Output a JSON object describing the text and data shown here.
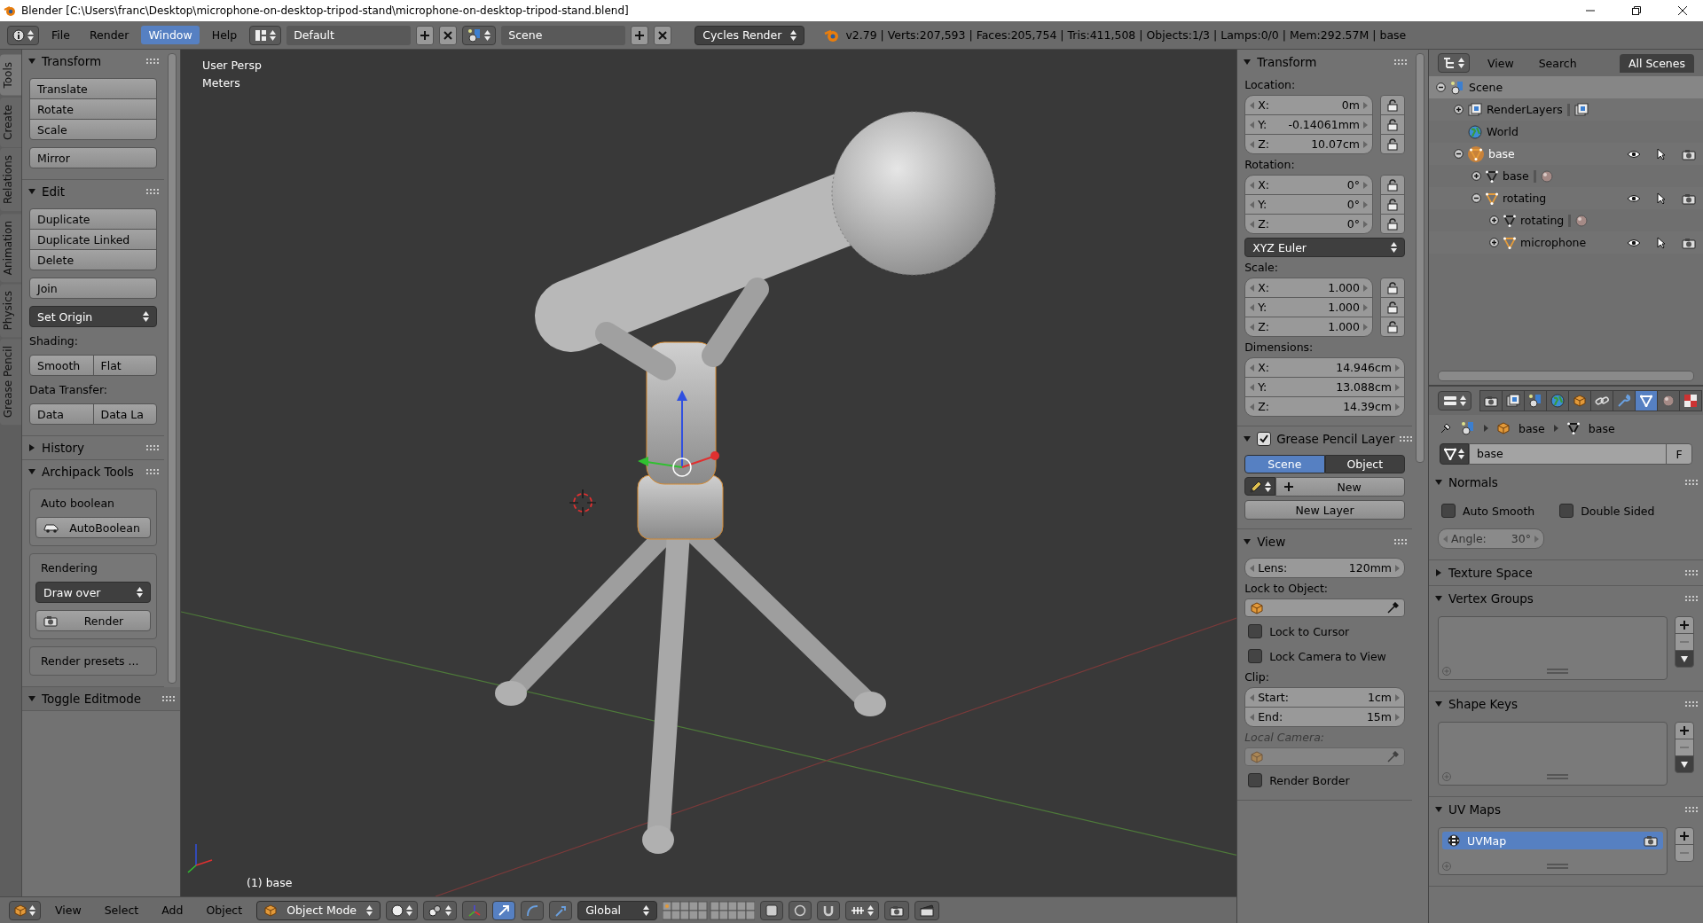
{
  "title_bar": {
    "title": "Blender [C:\\Users\\franc\\Desktop\\microphone-on-desktop-tripod-stand\\microphone-on-desktop-tripod-stand.blend]"
  },
  "top_header": {
    "menus": [
      {
        "label": "File",
        "selected": false
      },
      {
        "label": "Render",
        "selected": false
      },
      {
        "label": "Window",
        "selected": true
      },
      {
        "label": "Help",
        "selected": false
      }
    ],
    "layout": "Default",
    "scene": "Scene",
    "engine": "Cycles Render",
    "stats": "v2.79 | Verts:207,593 | Faces:205,754 | Tris:411,508 | Objects:1/3 | Lamps:0/0 | Mem:292.57M | base"
  },
  "tool_tabs": [
    {
      "label": "Tools",
      "selected": true
    },
    {
      "label": "Create",
      "selected": false
    },
    {
      "label": "Relations",
      "selected": false
    },
    {
      "label": "Animation",
      "selected": false
    },
    {
      "label": "Physics",
      "selected": false
    },
    {
      "label": "Grease Pencil",
      "selected": false
    }
  ],
  "tool_panel": {
    "sections": [
      {
        "title": "Transform",
        "expanded": true,
        "items": [
          {
            "kind": "buttons",
            "labels": [
              "Translate",
              "Rotate",
              "Scale"
            ]
          },
          {
            "kind": "button",
            "label": "Mirror"
          }
        ]
      },
      {
        "title": "Edit",
        "expanded": true,
        "items": [
          {
            "kind": "buttons",
            "labels": [
              "Duplicate",
              "Duplicate Linked",
              "Delete"
            ]
          },
          {
            "kind": "button",
            "label": "Join"
          },
          {
            "kind": "dropdown",
            "label": "Set Origin"
          },
          {
            "kind": "label",
            "text": "Shading:",
            "disabled": false
          },
          {
            "kind": "button_row",
            "labels": [
              "Smooth",
              "Flat"
            ]
          },
          {
            "kind": "label",
            "text": "Data Transfer:",
            "disabled": false
          },
          {
            "kind": "button_row",
            "labels": [
              "Data",
              "Data La"
            ]
          }
        ]
      },
      {
        "title": "History",
        "expanded": false
      },
      {
        "title": "Archipack Tools",
        "expanded": true,
        "items": [
          {
            "kind": "box",
            "items": [
              {
                "kind": "label",
                "text": "Auto boolean",
                "disabled": false
              },
              {
                "kind": "vehicle_button",
                "label": "AutoBoolean"
              }
            ]
          },
          {
            "kind": "box",
            "items": [
              {
                "kind": "label",
                "text": "Rendering",
                "disabled": false
              },
              {
                "kind": "dropdown",
                "label": "Draw over"
              },
              {
                "kind": "camera_button",
                "label": "Render"
              }
            ]
          },
          {
            "kind": "box",
            "items": [
              {
                "kind": "label",
                "text": "Render presets ...",
                "disabled": false
              }
            ]
          }
        ]
      }
    ],
    "redo": {
      "title": "Toggle Editmode",
      "expanded": true
    }
  },
  "viewport": {
    "view_name": "User Persp",
    "units": "Meters",
    "object_label": "(1) base"
  },
  "bottom_header": {
    "menus": [
      "View",
      "Select",
      "Add",
      "Object"
    ],
    "mode": "Object Mode",
    "orientation": "Global"
  },
  "n_panel": {
    "sections": [
      {
        "title": "Transform",
        "expanded": true,
        "items": [
          {
            "kind": "label",
            "text": "Location:",
            "disabled": false
          },
          {
            "kind": "fields",
            "locks": true,
            "disabled": false,
            "rows": [
              {
                "label": "X:",
                "value": "0m"
              },
              {
                "label": "Y:",
                "value": "-0.14061mm"
              },
              {
                "label": "Z:",
                "value": "10.07cm"
              }
            ]
          },
          {
            "kind": "label",
            "text": "Rotation:",
            "disabled": false
          },
          {
            "kind": "fields",
            "locks": true,
            "disabled": false,
            "rows": [
              {
                "label": "X:",
                "value": "0°"
              },
              {
                "label": "Y:",
                "value": "0°"
              },
              {
                "label": "Z:",
                "value": "0°"
              }
            ]
          },
          {
            "kind": "dropdown",
            "label": "XYZ Euler"
          },
          {
            "kind": "label",
            "text": "Scale:",
            "disabled": false
          },
          {
            "kind": "fields",
            "locks": true,
            "disabled": false,
            "rows": [
              {
                "label": "X:",
                "value": "1.000"
              },
              {
                "label": "Y:",
                "value": "1.000"
              },
              {
                "label": "Z:",
                "value": "1.000"
              }
            ]
          },
          {
            "kind": "label",
            "text": "Dimensions:",
            "disabled": false
          },
          {
            "kind": "fields",
            "locks": false,
            "disabled": false,
            "rows": [
              {
                "label": "X:",
                "value": "14.946cm"
              },
              {
                "label": "Y:",
                "value": "13.088cm"
              },
              {
                "label": "Z:",
                "value": "14.39cm"
              }
            ]
          }
        ]
      },
      {
        "title": "Grease Pencil Layer",
        "expanded": true,
        "checked": true,
        "items": [
          {
            "kind": "toggle_row",
            "options": [
              {
                "label": "Scene",
                "selected": true
              },
              {
                "label": "Object",
                "selected": false
              }
            ]
          },
          {
            "kind": "new_row",
            "label": "New"
          },
          {
            "kind": "button",
            "label": "New Layer"
          }
        ]
      },
      {
        "title": "View",
        "expanded": true,
        "items": [
          {
            "kind": "fields",
            "locks": false,
            "disabled": false,
            "rows": [
              {
                "label": "Lens:",
                "value": "120mm"
              }
            ]
          },
          {
            "kind": "label",
            "text": "Lock to Object:",
            "disabled": false
          },
          {
            "kind": "object_field",
            "disabled": false
          },
          {
            "kind": "checkbox",
            "label": "Lock to Cursor",
            "checked": false
          },
          {
            "kind": "checkbox",
            "label": "Lock Camera to View",
            "checked": false
          },
          {
            "kind": "label",
            "text": "Clip:",
            "disabled": false
          },
          {
            "kind": "fields",
            "locks": false,
            "disabled": false,
            "rows": [
              {
                "label": "Start:",
                "value": "1cm"
              },
              {
                "label": "End:",
                "value": "15m"
              }
            ]
          },
          {
            "kind": "label",
            "text": "Local Camera:",
            "disabled": true
          },
          {
            "kind": "object_field",
            "disabled": true
          },
          {
            "kind": "checkbox",
            "label": "Render Border",
            "checked": false
          }
        ]
      }
    ]
  },
  "outliner": {
    "menus": [
      "View",
      "Search"
    ],
    "filter": "All Scenes",
    "tree": [
      {
        "label": "Scene",
        "kind": "scene",
        "expanded": true,
        "selected": true,
        "children": [
          {
            "label": "RenderLayers",
            "kind": "renderlayers",
            "expanded": false,
            "selected": false
          },
          {
            "label": "World",
            "kind": "world",
            "selected": false
          },
          {
            "label": "base",
            "kind": "object",
            "expanded": true,
            "selected": false,
            "active": true,
            "children": [
              {
                "label": "base",
                "kind": "mesh",
                "expanded": false,
                "selected": false
              },
              {
                "label": "rotating",
                "kind": "object",
                "expanded": true,
                "selected": false,
                "active": false,
                "children": [
                  {
                    "label": "rotating",
                    "kind": "mesh",
                    "expanded": false,
                    "selected": false
                  },
                  {
                    "label": "microphone",
                    "kind": "object",
                    "expanded": false,
                    "selected": false,
                    "active": false
                  }
                ]
              }
            ]
          }
        ]
      }
    ]
  },
  "properties": {
    "tabs": [
      {
        "kind": "render",
        "selected": false
      },
      {
        "kind": "layers",
        "selected": false
      },
      {
        "kind": "scene",
        "selected": false
      },
      {
        "kind": "world",
        "selected": false
      },
      {
        "kind": "object",
        "selected": false
      },
      {
        "kind": "constraints",
        "selected": false
      },
      {
        "kind": "modifiers",
        "selected": false
      },
      {
        "kind": "data",
        "selected": true
      },
      {
        "kind": "material",
        "selected": false
      },
      {
        "kind": "texture",
        "selected": false
      }
    ],
    "breadcrumb": [
      "base",
      "base"
    ],
    "datablock": "base",
    "fake_user": "F",
    "sections": [
      {
        "title": "Normals",
        "expanded": true,
        "items": [
          {
            "kind": "checkbox_row",
            "boxes": [
              {
                "label": "Auto Smooth",
                "checked": false
              },
              {
                "label": "Double Sided",
                "checked": false
              }
            ]
          },
          {
            "kind": "small_field",
            "disabled": true,
            "label": "Angle:",
            "value": "30°"
          }
        ]
      },
      {
        "title": "Texture Space",
        "expanded": false
      },
      {
        "title": "Vertex Groups",
        "expanded": true,
        "items": [
          {
            "kind": "list"
          }
        ]
      },
      {
        "title": "Shape Keys",
        "expanded": true,
        "items": [
          {
            "kind": "list"
          }
        ]
      },
      {
        "title": "UV Maps",
        "expanded": true,
        "items": [
          {
            "kind": "list",
            "rows": [
              {
                "label": "UVMap",
                "selected": true
              }
            ]
          }
        ]
      }
    ]
  }
}
